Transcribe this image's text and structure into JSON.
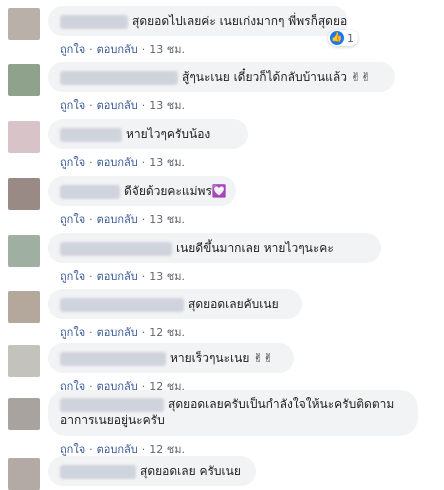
{
  "actions": {
    "like": "ถูกใจ",
    "reply": "ตอบกลับ",
    "separator": "·"
  },
  "comments": [
    {
      "text": "สุดยอดไปเลยค่ะ เนยเก่งมากๆ พี่พรก็สุดยอด",
      "time": "13 ชม.",
      "reaction_count": "1"
    },
    {
      "text": "สู้ๆนะเนย เดี๋ยวก็ได้กลับบ้านแล้ว",
      "emoji": "✌✌",
      "time": "13 ชม."
    },
    {
      "text": "หายไวๆครับน้อง",
      "time": "13 ชม."
    },
    {
      "text": "ดีจัยด้วยคะแม่พร",
      "emoji": "💟",
      "time": "13 ชม."
    },
    {
      "text": "เนยดีขึ้นมากเลย หายไวๆนะคะ",
      "time": "13 ชม."
    },
    {
      "text": "สุดยอดเลยคับเนย",
      "time": "12 ชม."
    },
    {
      "text": "หายเร็วๆนะเนย",
      "emoji": "✌✌",
      "time": "12 ชม."
    },
    {
      "text": "สุดยอดเลยครับเป็นกำลังใจให้นะครับติดตามอาการเนยอยู่นะครับ",
      "time": "12 ชม."
    },
    {
      "text": "สุดยอดเลย ครับเนย",
      "time": ""
    }
  ]
}
